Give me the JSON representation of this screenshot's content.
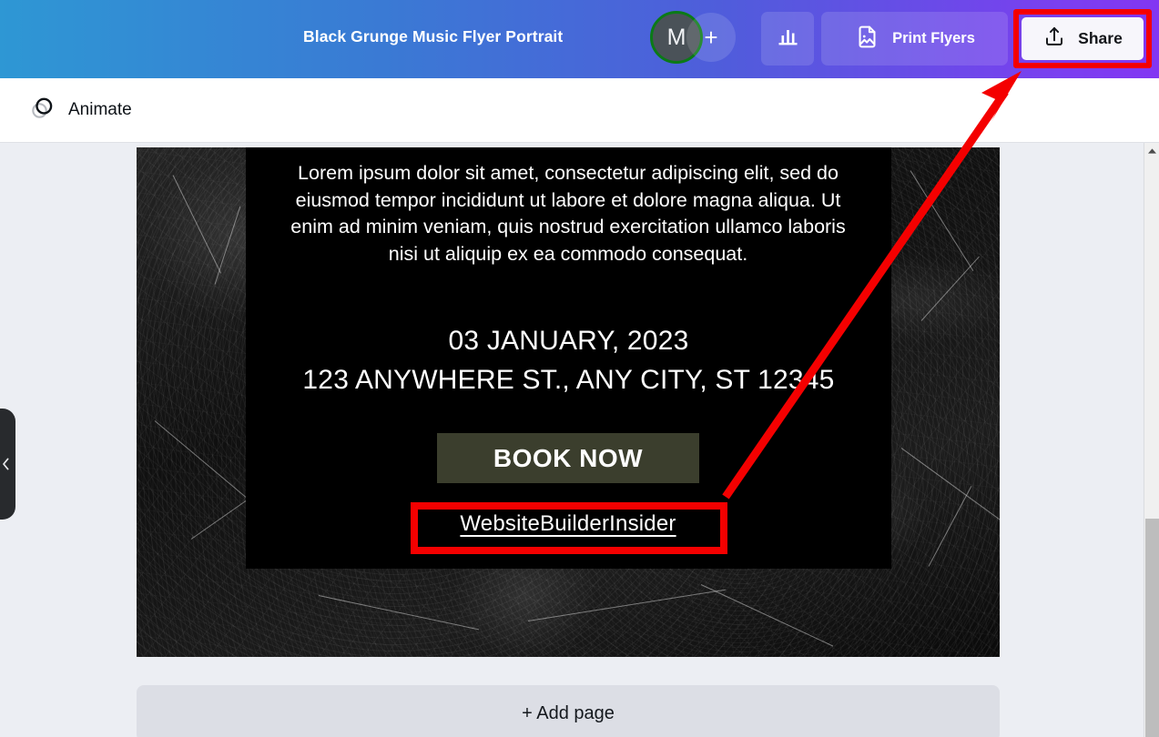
{
  "header": {
    "title": "Black Grunge Music Flyer Portrait",
    "avatar": {
      "initial": "M",
      "ring_color": "#0b7a17",
      "fill_color": "#4a5258"
    },
    "add_collaborator_label": "+",
    "chart_button_icon": "bar-chart-icon",
    "print_flyers_label": "Print Flyers",
    "print_flyers_icon": "image-document-icon",
    "share_label": "Share",
    "share_icon": "upload-share-icon",
    "gradient_from": "#2e97d4",
    "gradient_to": "#8236f2"
  },
  "toolbar": {
    "animate_label": "Animate",
    "animate_icon": "overlapping-circles-icon"
  },
  "flyer": {
    "body_text": "Lorem ipsum dolor sit amet, consectetur adipiscing elit, sed do eiusmod tempor incididunt ut labore et dolore magna aliqua. Ut enim ad minim veniam, quis nostrud exercitation ullamco laboris nisi ut aliquip ex ea commodo consequat.",
    "date": "03 JANUARY, 2023",
    "address": "123 ANYWHERE ST., ANY CITY, ST 12345",
    "book_now_label": "BOOK NOW",
    "book_now_bg": "#3b3e2d",
    "link_label": "WebsiteBuilderInsider",
    "background_color": "#000000"
  },
  "annotations": {
    "highlight_color": "#f40000",
    "share_highlight": "Share button highlighted",
    "link_highlight": "WebsiteBuilderInsider link highlighted",
    "arrow": "red-arrow-pointing-to-share"
  },
  "footer": {
    "add_page_label": "+ Add page"
  },
  "scrollbar": {
    "up_arrow_icon": "scroll-up-arrow-icon",
    "thumb_color": "#bdbdbd"
  },
  "left_panel": {
    "collapse_icon": "chevron-left-icon"
  }
}
